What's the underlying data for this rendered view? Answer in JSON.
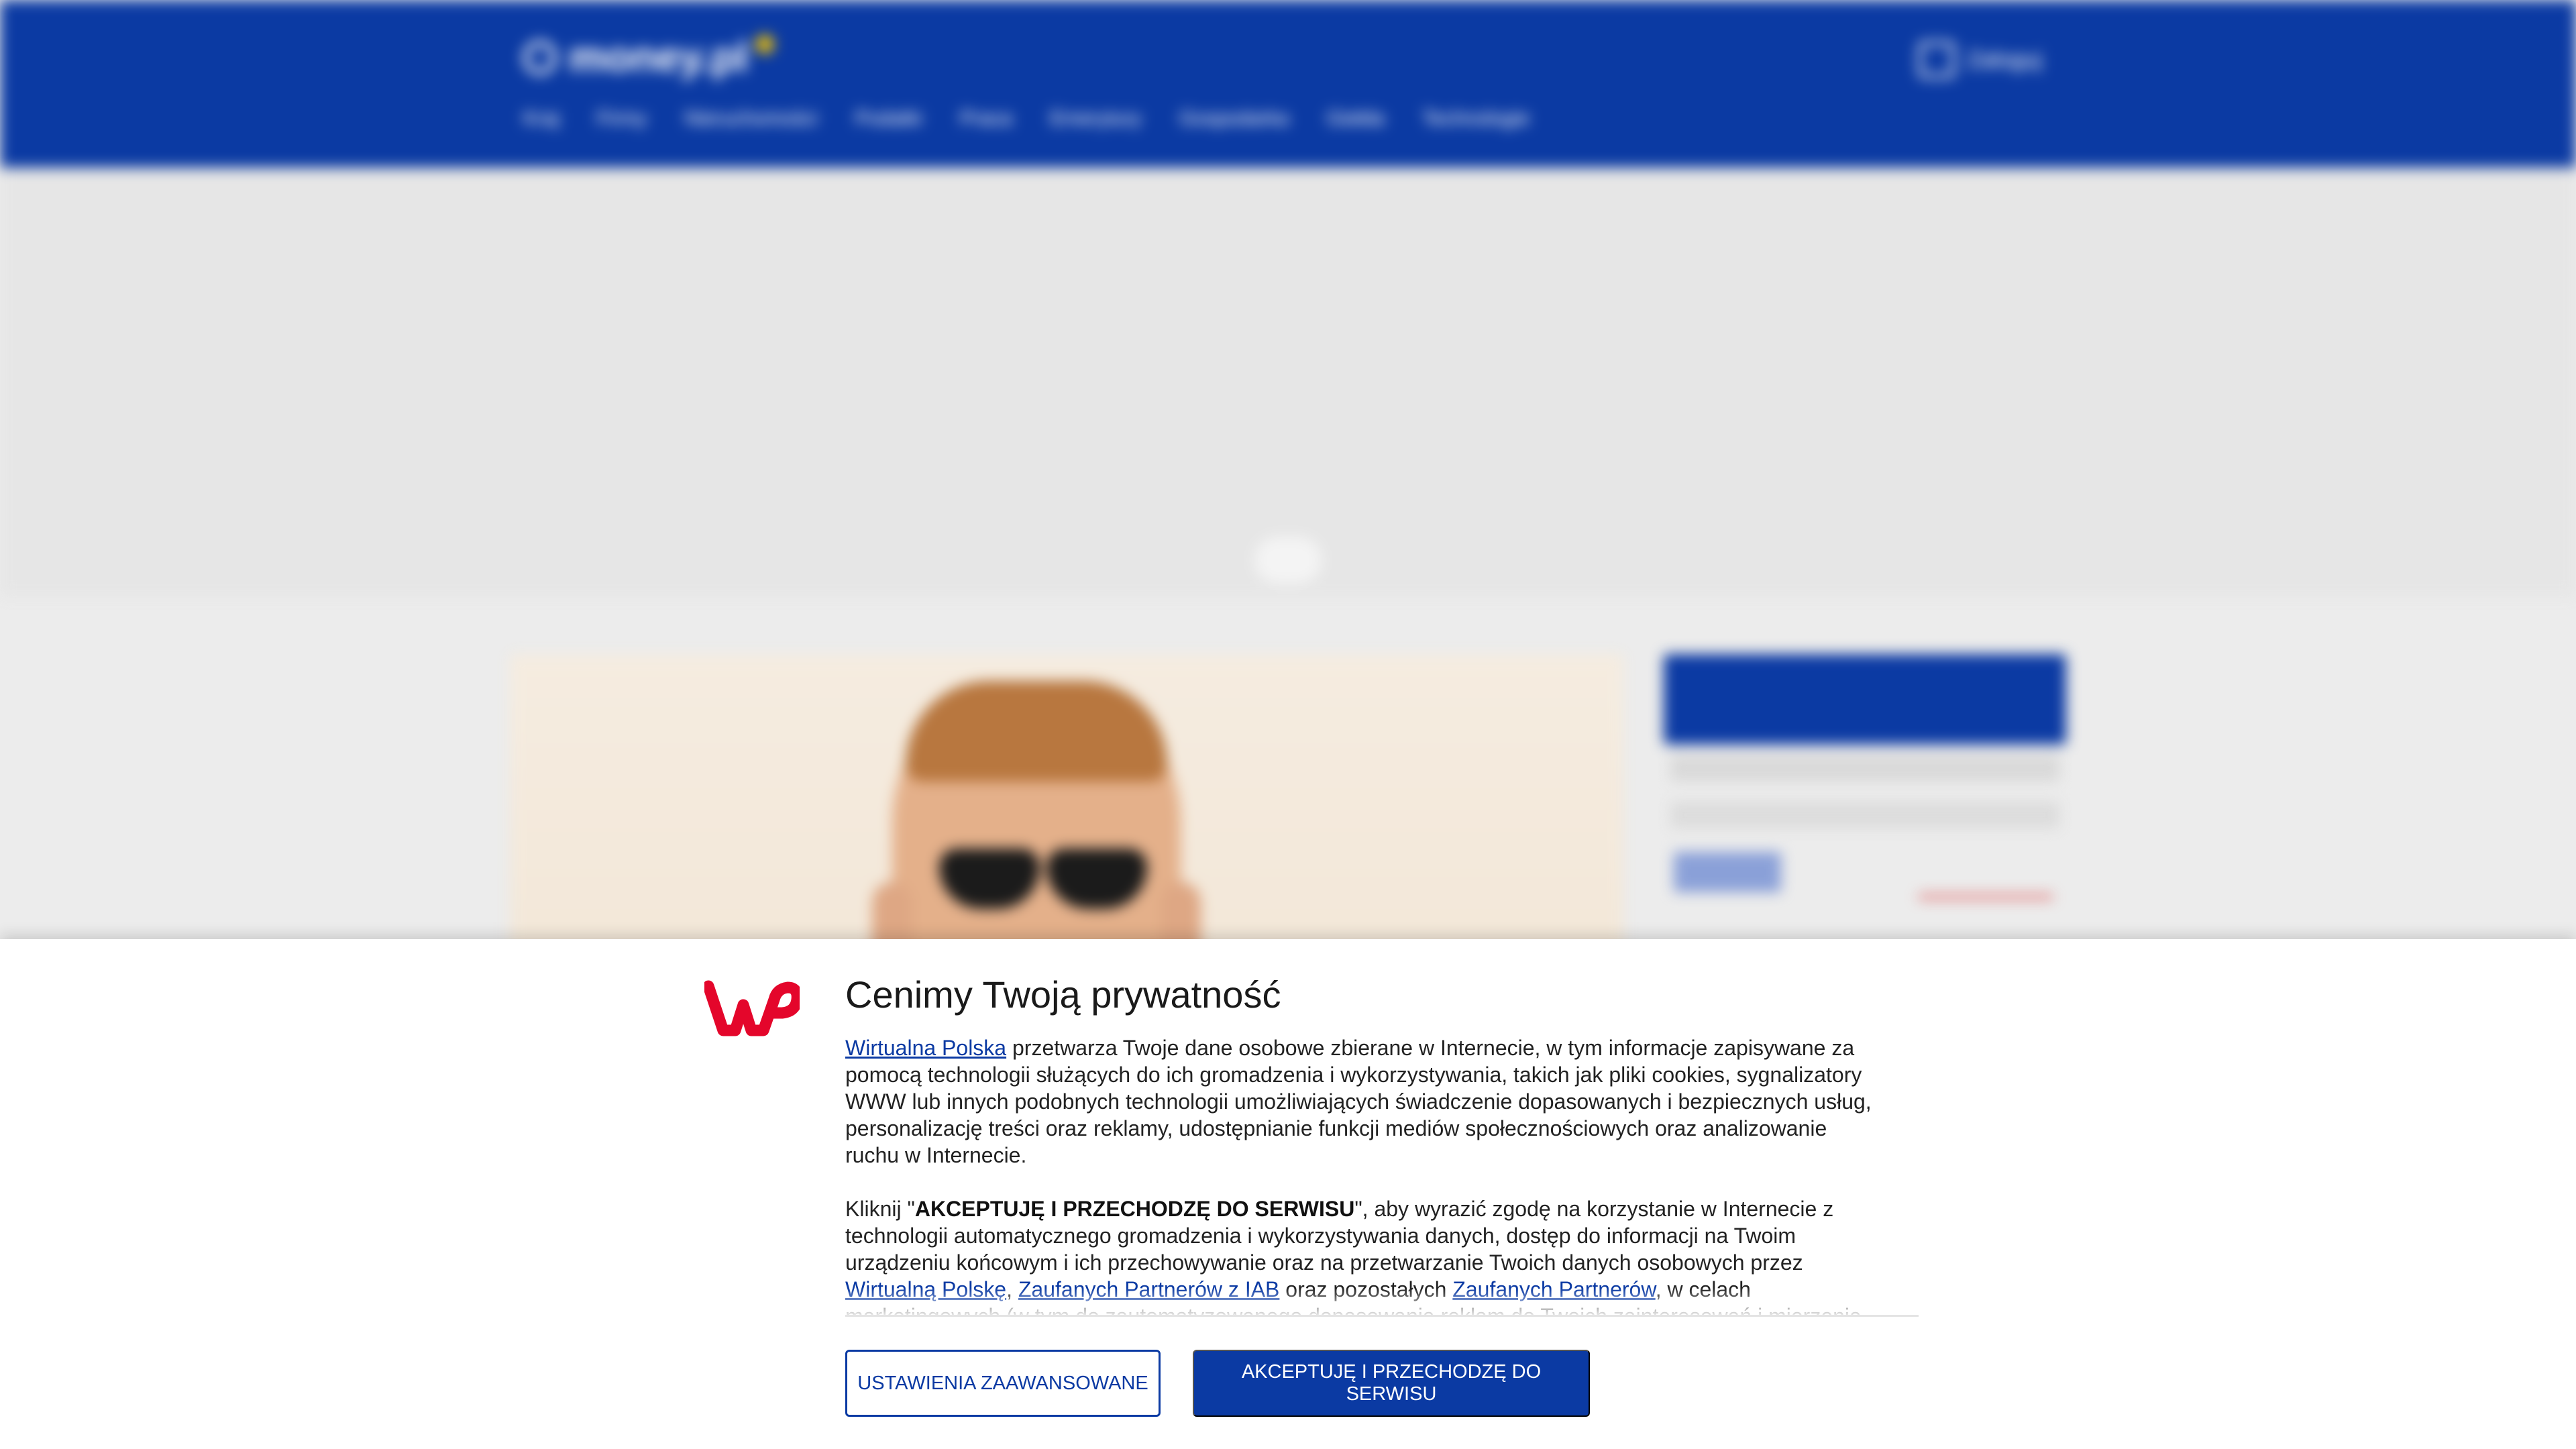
{
  "header": {
    "logo_text": "money.pl",
    "login_label": "Zaloguj",
    "nav": [
      {
        "label": "Kraj"
      },
      {
        "label": "Firmy"
      },
      {
        "label": "Nieruchomości"
      },
      {
        "label": "Podatki"
      },
      {
        "label": "Praca"
      },
      {
        "label": "Emerytury"
      },
      {
        "label": "Gospodarka"
      },
      {
        "label": "Giełda"
      },
      {
        "label": "Technologie"
      }
    ]
  },
  "consent": {
    "title": "Cenimy Twoją prywatność",
    "p1": {
      "link": "Wirtualna Polska",
      "text": " przetwarza Twoje dane osobowe zbierane w Internecie, w tym informacje zapisywane za pomocą technologii służących do ich gromadzenia i wykorzystywania, takich jak pliki cookies, sygnalizatory WWW lub innych podobnych technologii umożliwiających świadczenie dopasowanych i bezpiecznych usług, personalizację treści oraz reklamy, udostępnianie funkcji mediów społecznościowych oraz analizowanie ruchu w Internecie."
    },
    "p2": {
      "prefix": "Kliknij \"",
      "bold": "AKCEPTUJĘ I PRZECHODZĘ DO SERWISU",
      "mid": "\", aby wyrazić zgodę na korzystanie w Internecie z technologii automatycznego gromadzenia i wykorzystywania danych, dostęp do informacji na Twoim urządzeniu końcowym i ich przechowywanie oraz na przetwarzanie Twoich danych osobowych przez ",
      "link1": "Wirtualną Polskę",
      "sep1": ", ",
      "link2": "Zaufanych Partnerów z IAB",
      "sep2": " oraz pozostałych ",
      "link3": "Zaufanych Partnerów",
      "tail": ", w celach marketingowych (w tym do zautomatyzowanego dopasowania reklam do Twoich zainteresowań i mierzenia ich skuteczności) i pozostałych, które wskazujemy poniżej."
    },
    "btn_advanced": "USTAWIENIA ZAAWANSOWANE",
    "btn_accept": "AKCEPTUJĘ I PRZECHODZĘ DO SERWISU"
  },
  "colors": {
    "brand_blue": "#0b3aa3",
    "wp_red": "#e4062b"
  },
  "icons": [
    "wp-logo-icon",
    "money-logo-icon",
    "user-login-icon"
  ]
}
